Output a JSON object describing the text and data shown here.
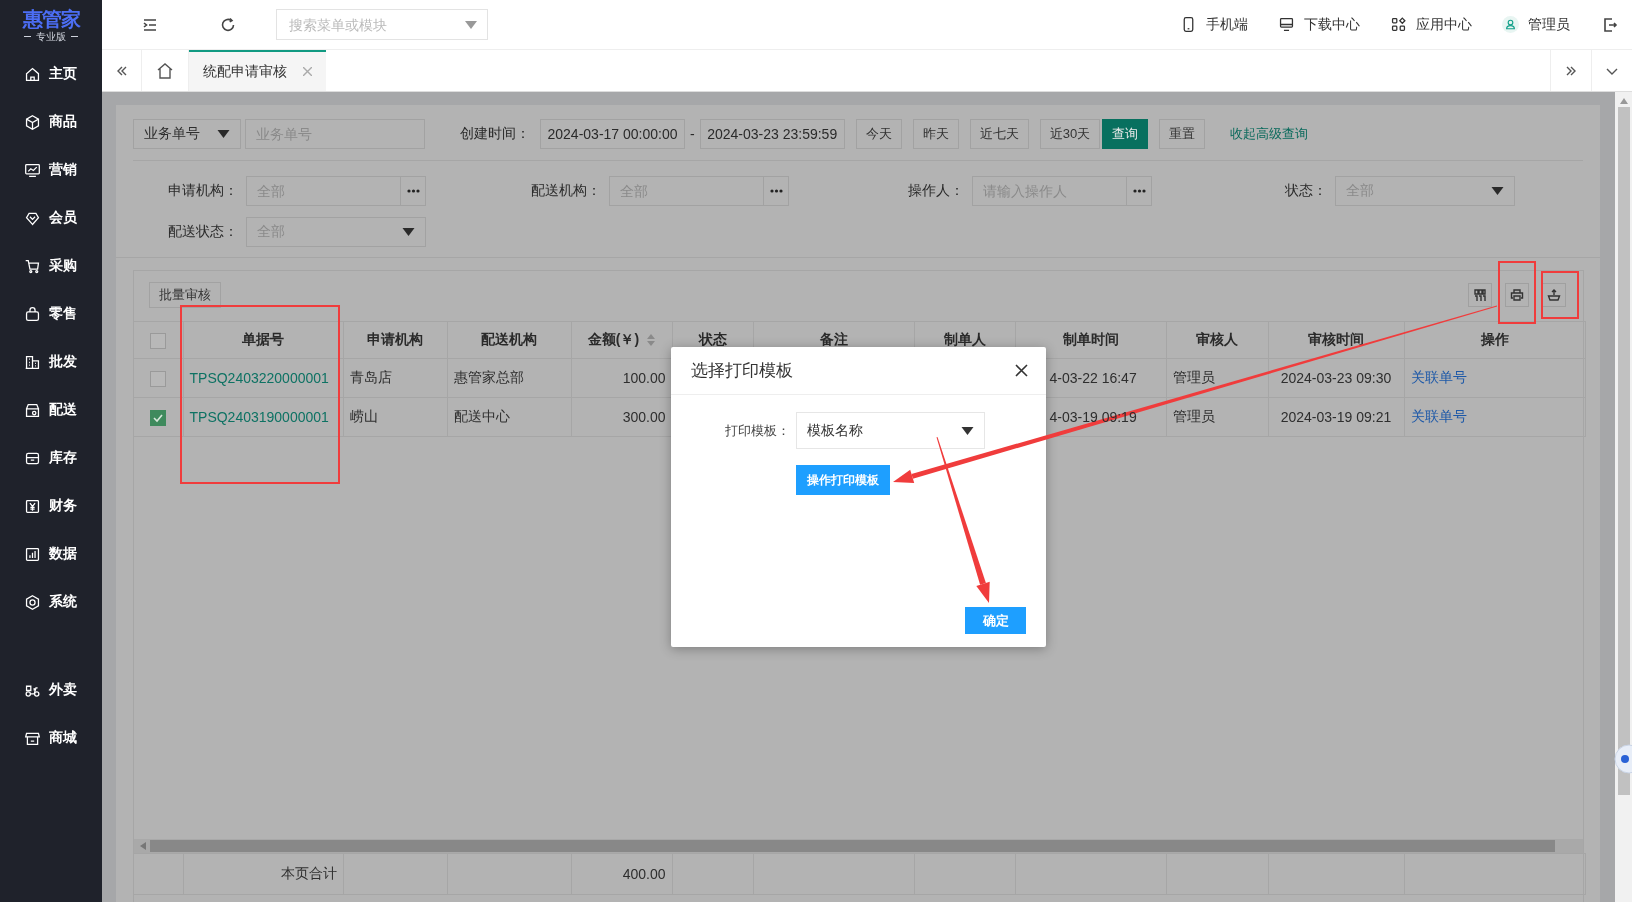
{
  "logo": {
    "name": "惠管家",
    "edition": "专业版"
  },
  "sidebar": {
    "items": [
      {
        "label": "主页"
      },
      {
        "label": "商品"
      },
      {
        "label": "营销"
      },
      {
        "label": "会员"
      },
      {
        "label": "采购"
      },
      {
        "label": "零售"
      },
      {
        "label": "批发"
      },
      {
        "label": "配送"
      },
      {
        "label": "库存"
      },
      {
        "label": "财务"
      },
      {
        "label": "数据"
      },
      {
        "label": "系统"
      }
    ],
    "extra_items": [
      {
        "label": "外卖"
      },
      {
        "label": "商城"
      }
    ]
  },
  "header": {
    "search": {
      "placeholder": "搜索菜单或模块"
    },
    "links": [
      "手机端",
      "下载中心",
      "应用中心"
    ],
    "user": "管理员"
  },
  "tabs": [
    {
      "label": "统配申请审核",
      "selected": true
    }
  ],
  "filters": {
    "search_type": "业务单号",
    "search": {
      "placeholder": "业务单号"
    },
    "date_label": "创建时间：",
    "date_from": "2024-03-17 00:00:00",
    "date_separator": "-",
    "date_to": "2024-03-23 23:59:59",
    "quick_buttons": [
      "今天",
      "昨天",
      "近七天",
      "近30天"
    ],
    "query_button": "查询",
    "reset_button": "重置",
    "toggle_link": "收起高级查询",
    "fields": [
      {
        "label": "申请机构：",
        "kind": "picker",
        "placeholder": "全部"
      },
      {
        "label": "配送机构：",
        "kind": "picker",
        "placeholder": "全部"
      },
      {
        "label": "操作人：",
        "kind": "picker",
        "placeholder": "请输入操作人"
      },
      {
        "label": "状态：",
        "kind": "select",
        "placeholder": "全部"
      },
      {
        "label": "配送状态：",
        "kind": "select",
        "placeholder": "全部"
      }
    ]
  },
  "table": {
    "batch_button": "批量审核",
    "all_selected": false,
    "columns": [
      {
        "label": "单据号",
        "sortable": false
      },
      {
        "label": "申请机构",
        "sortable": false
      },
      {
        "label": "配送机构",
        "sortable": false
      },
      {
        "label": "金额(￥)",
        "sortable": true
      },
      {
        "label": "状态",
        "sortable": false
      },
      {
        "label": "备注",
        "sortable": false
      },
      {
        "label": "制单人",
        "sortable": false
      },
      {
        "label": "制单时间",
        "sortable": false
      },
      {
        "label": "审核人",
        "sortable": false
      },
      {
        "label": "审核时间",
        "sortable": false
      },
      {
        "label": "操作",
        "sortable": false
      }
    ],
    "rows": [
      {
        "selected": false,
        "doc_no": "TPSQ2403220000001",
        "applicant": "青岛店",
        "distributor": "惠管家总部",
        "amount": "100.00",
        "created_time": "4-03-22 16:47",
        "reviewer": "管理员",
        "review_time": "2024-03-23 09:30",
        "action": "关联单号"
      },
      {
        "selected": true,
        "doc_no": "TPSQ2403190000001",
        "applicant": "崂山",
        "distributor": "配送中心",
        "amount": "300.00",
        "created_time": "4-03-19 09:19",
        "reviewer": "管理员",
        "review_time": "2024-03-19 09:21",
        "action": "关联单号"
      }
    ],
    "footer": {
      "label": "本页合计",
      "amount": "400.00"
    }
  },
  "dialog": {
    "title": "选择打印模板",
    "field_label": "打印模板：",
    "template": "模板名称",
    "design_button": "操作打印模板",
    "confirm_button": "确定"
  }
}
